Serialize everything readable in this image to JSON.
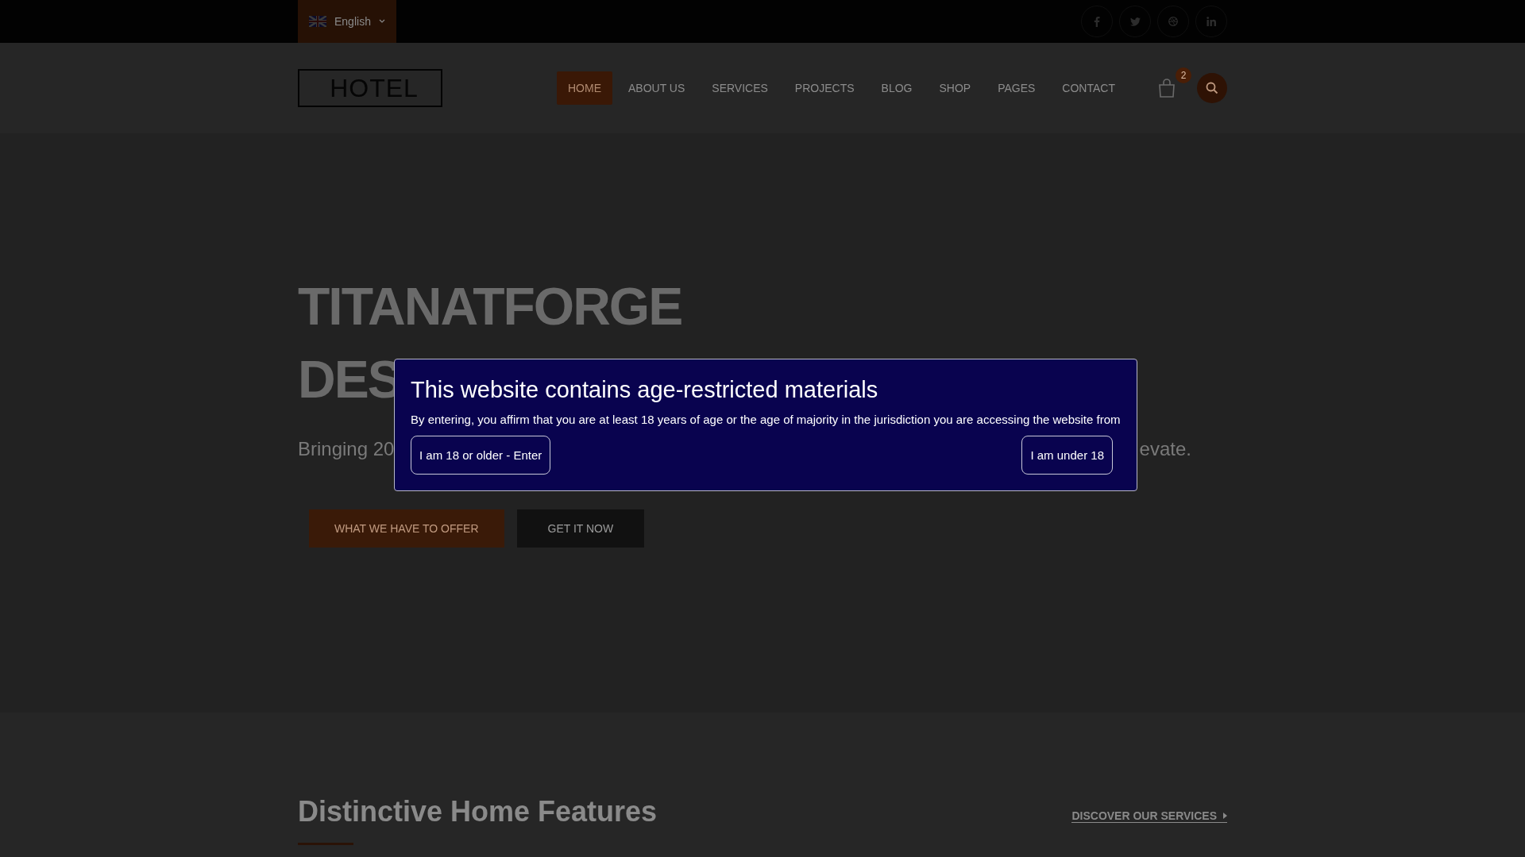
{
  "top_bar": {
    "language": {
      "label": "English"
    },
    "social": [
      {
        "kind": "facebook"
      },
      {
        "kind": "twitter"
      },
      {
        "kind": "dribbble"
      },
      {
        "kind": "linkedin"
      }
    ]
  },
  "header": {
    "logo": "HOTEL",
    "nav": [
      {
        "label": "HOME",
        "selected": true
      },
      {
        "label": "ABOUT US",
        "selected": false
      },
      {
        "label": "SERVICES",
        "selected": false
      },
      {
        "label": "PROJECTS",
        "selected": false
      },
      {
        "label": "BLOG",
        "selected": false
      },
      {
        "label": "SHOP",
        "selected": false
      },
      {
        "label": "PAGES",
        "selected": false
      },
      {
        "label": "CONTACT",
        "selected": false
      }
    ],
    "cart_count": "2"
  },
  "hero": {
    "title_line_1": "TITANATFORGE",
    "title_line_2": "DES",
    "subtitle_left": "Bringing 20",
    "subtitle_right": "evate.",
    "buttons": [
      {
        "label": "WHAT WE HAVE TO OFFER",
        "kind": "primary"
      },
      {
        "label": "GET IT NOW",
        "kind": "dark"
      }
    ]
  },
  "age_modal": {
    "title": "This website contains age-restricted materials",
    "text": "By entering, you affirm that you are at least 18 years of age or the age of majority in the jurisdiction you are accessing the website from",
    "buttons": [
      "I am 18 or older - Enter",
      "I am under 18"
    ]
  },
  "features": {
    "title": "Distinctive Home Features",
    "link": "DISCOVER OUR SERVICES"
  }
}
